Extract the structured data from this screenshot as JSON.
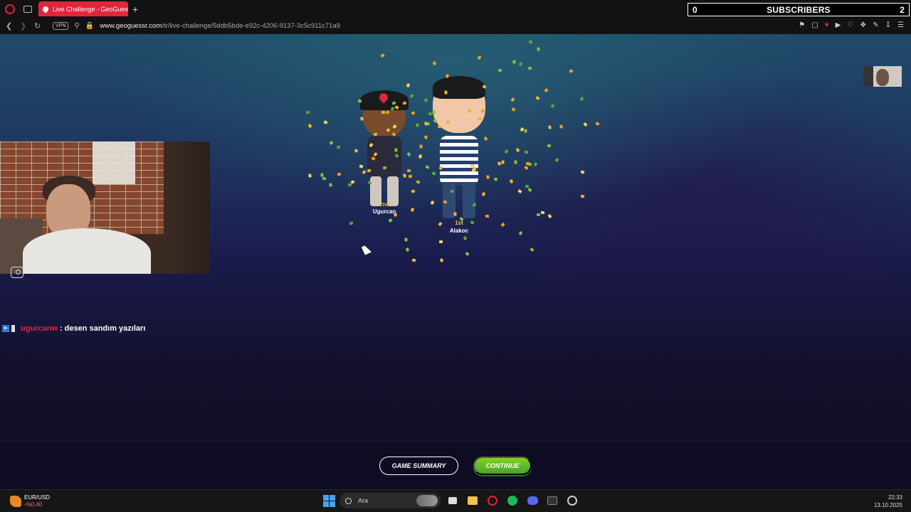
{
  "browser": {
    "tab_title": "Live Challenge - GeoGuessr",
    "url_host": "www.geoguessr.com",
    "url_path": "/tr/live-challenge/5ddb5bde-e92c-4206-9137-3c5c911c71a9",
    "vpn_label": "VPN",
    "accent_color": "#e0263a"
  },
  "subscriber_bar": {
    "left_count": "0",
    "label": "SUBSCRIBERS",
    "right_count": "2"
  },
  "podium": {
    "first": {
      "rank": "1st",
      "name": "Alakoc"
    },
    "second": {
      "rank": "2nd",
      "name": "Ugurcan"
    }
  },
  "chat": {
    "username": "ugurcanw",
    "separator": ":",
    "message": "desen sandım yazıları"
  },
  "actions": {
    "summary_label": "GAME SUMMARY",
    "continue_label": "CONTINUE",
    "continue_color": "#6fc52a"
  },
  "taskbar": {
    "ticker_pair": "EUR/USD",
    "ticker_change": "-%0,40",
    "search_placeholder": "Ara",
    "time": "22:33",
    "date": "13.10.2025"
  },
  "icons": [
    "opera-icon",
    "tab-switcher-icon",
    "back-icon",
    "forward-icon",
    "reload-icon",
    "lock-icon",
    "pin-icon",
    "snapshot-icon",
    "heart-icon",
    "play-icon",
    "extensions-icon",
    "download-icon",
    "menu-icon",
    "chat-bubble-icon",
    "windows-start-icon",
    "search-icon",
    "spotify-icon",
    "discord-icon",
    "terminal-icon",
    "steam-icon"
  ]
}
